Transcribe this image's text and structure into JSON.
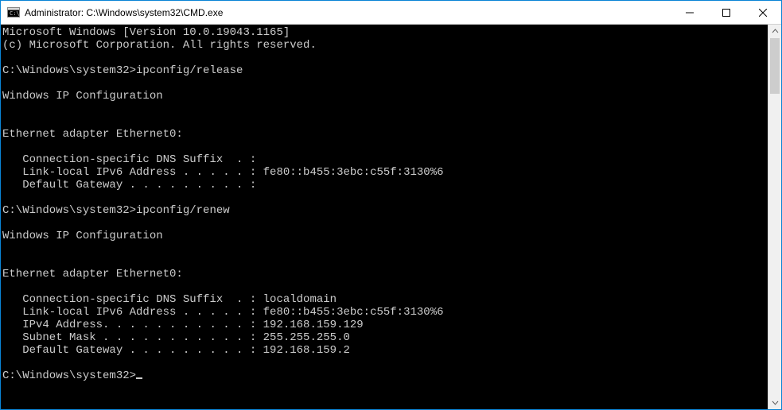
{
  "window": {
    "title": "Administrator: C:\\Windows\\system32\\CMD.exe"
  },
  "terminal": {
    "lines": [
      "Microsoft Windows [Version 10.0.19043.1165]",
      "(c) Microsoft Corporation. All rights reserved.",
      "",
      "C:\\Windows\\system32>ipconfig/release",
      "",
      "Windows IP Configuration",
      "",
      "",
      "Ethernet adapter Ethernet0:",
      "",
      "   Connection-specific DNS Suffix  . :",
      "   Link-local IPv6 Address . . . . . : fe80::b455:3ebc:c55f:3130%6",
      "   Default Gateway . . . . . . . . . :",
      "",
      "C:\\Windows\\system32>ipconfig/renew",
      "",
      "Windows IP Configuration",
      "",
      "",
      "Ethernet adapter Ethernet0:",
      "",
      "   Connection-specific DNS Suffix  . : localdomain",
      "   Link-local IPv6 Address . . . . . : fe80::b455:3ebc:c55f:3130%6",
      "   IPv4 Address. . . . . . . . . . . : 192.168.159.129",
      "   Subnet Mask . . . . . . . . . . . : 255.255.255.0",
      "   Default Gateway . . . . . . . . . : 192.168.159.2",
      "",
      "C:\\Windows\\system32>"
    ],
    "prompt_has_cursor": true
  }
}
